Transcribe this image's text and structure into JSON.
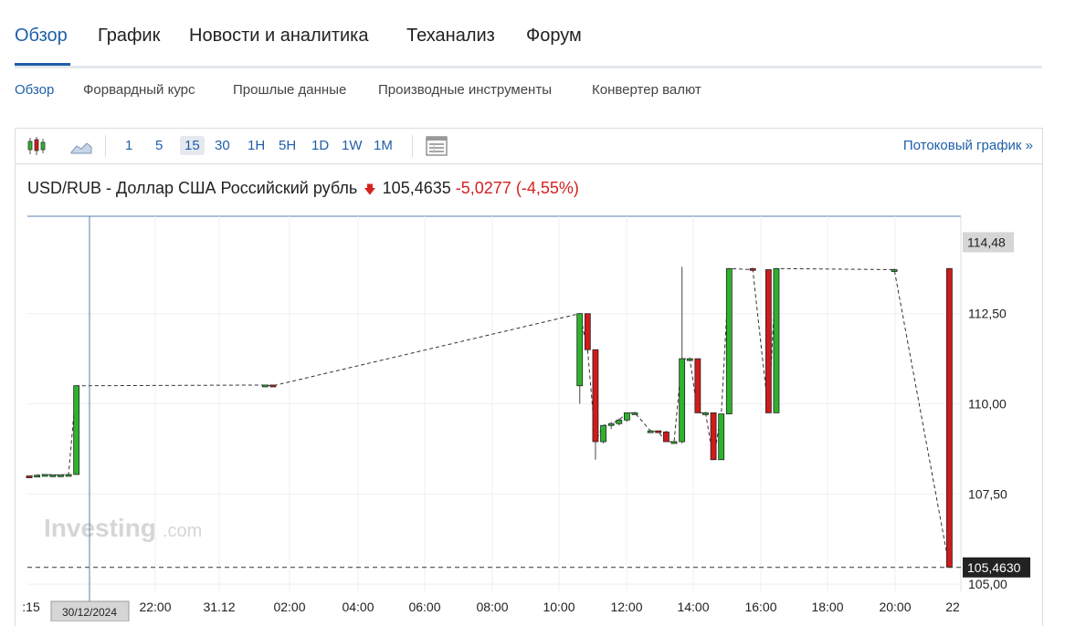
{
  "tabs": [
    {
      "label": "Обзор",
      "active": true
    },
    {
      "label": "График",
      "active": false
    },
    {
      "label": "Новости и аналитика",
      "active": false
    },
    {
      "label": "Теханализ",
      "active": false
    },
    {
      "label": "Форум",
      "active": false
    }
  ],
  "subtabs": [
    {
      "label": "Обзор",
      "active": true
    },
    {
      "label": "Форвардный курс",
      "active": false
    },
    {
      "label": "Прошлые данные",
      "active": false
    },
    {
      "label": "Производные инструменты",
      "active": false
    },
    {
      "label": "Конвертер валют",
      "active": false
    }
  ],
  "toolbar": {
    "icons": [
      "candlestick-chart-icon",
      "area-chart-icon",
      "data-table-icon"
    ],
    "intervals": [
      "1",
      "5",
      "15",
      "30",
      "1H",
      "5H",
      "1D",
      "1W",
      "1M"
    ],
    "active_interval": "15",
    "stream_label": "Потоковый график »"
  },
  "quote": {
    "name": "USD/RUB - Доллар США Российский рубль",
    "price": "105,4635",
    "change": "-5,0277",
    "change_pct": "(-4,55%)",
    "direction_color": "#d42121"
  },
  "colors": {
    "up": "#2db32d",
    "down": "#d11a1a",
    "accent": "#1f5fa8"
  },
  "chart_data": {
    "type": "candlestick",
    "y_ticks": [
      "112,50",
      "110,00",
      "107,50",
      "105,00"
    ],
    "y_tick_values": [
      112.5,
      110.0,
      107.5,
      105.0
    ],
    "ylim": [
      104.8,
      115.2
    ],
    "x_ticks": [
      ":15",
      "22:00",
      "31.12",
      "02:00",
      "04:00",
      "06:00",
      "08:00",
      "10:00",
      "12:00",
      "14:00",
      "16:00",
      "18:00",
      "20:00",
      "22"
    ],
    "high_label": "114,48",
    "last_label": "105,4630",
    "last_value": 105.463,
    "high_value": 114.48,
    "crosshair_date": "30/12/2024",
    "watermark": "Investing.com",
    "candles": [
      {
        "t": 0,
        "o": 108.0,
        "h": 108.0,
        "l": 107.96,
        "c": 107.98
      },
      {
        "t": 1,
        "o": 107.98,
        "h": 108.02,
        "l": 107.98,
        "c": 108.02
      },
      {
        "t": 2,
        "o": 108.02,
        "h": 108.04,
        "l": 108.0,
        "c": 108.04
      },
      {
        "t": 3,
        "o": 108.03,
        "h": 108.04,
        "l": 108.02,
        "c": 108.03
      },
      {
        "t": 4,
        "o": 108.0,
        "h": 108.04,
        "l": 108.0,
        "c": 108.03
      },
      {
        "t": 5,
        "o": 108.03,
        "h": 108.05,
        "l": 108.01,
        "c": 108.04
      },
      {
        "t": 6,
        "o": 108.04,
        "h": 110.5,
        "l": 108.03,
        "c": 110.5
      },
      {
        "t": 30,
        "o": 110.5,
        "h": 110.52,
        "l": 110.48,
        "c": 110.52
      },
      {
        "t": 31,
        "o": 110.52,
        "h": 110.53,
        "l": 110.5,
        "c": 110.5
      },
      {
        "t": 70,
        "o": 110.5,
        "h": 112.5,
        "l": 110.0,
        "c": 112.5
      },
      {
        "t": 71,
        "o": 112.5,
        "h": 112.5,
        "l": 111.5,
        "c": 111.5
      },
      {
        "t": 72,
        "o": 111.5,
        "h": 111.5,
        "l": 108.45,
        "c": 108.95
      },
      {
        "t": 73,
        "o": 108.95,
        "h": 109.4,
        "l": 108.9,
        "c": 109.4
      },
      {
        "t": 74,
        "o": 109.4,
        "h": 109.5,
        "l": 109.3,
        "c": 109.45
      },
      {
        "t": 75,
        "o": 109.45,
        "h": 109.6,
        "l": 109.4,
        "c": 109.55
      },
      {
        "t": 76,
        "o": 109.55,
        "h": 109.75,
        "l": 109.5,
        "c": 109.75
      },
      {
        "t": 77,
        "o": 109.75,
        "h": 109.78,
        "l": 109.7,
        "c": 109.75
      },
      {
        "t": 79,
        "o": 109.25,
        "h": 109.27,
        "l": 109.22,
        "c": 109.25
      },
      {
        "t": 80,
        "o": 109.25,
        "h": 109.25,
        "l": 109.22,
        "c": 109.22
      },
      {
        "t": 81,
        "o": 109.22,
        "h": 109.25,
        "l": 108.95,
        "c": 108.95
      },
      {
        "t": 82,
        "o": 108.95,
        "h": 108.97,
        "l": 108.9,
        "c": 108.95
      },
      {
        "t": 83,
        "o": 108.95,
        "h": 113.8,
        "l": 108.9,
        "c": 111.25
      },
      {
        "t": 84,
        "o": 111.25,
        "h": 111.28,
        "l": 111.2,
        "c": 111.25
      },
      {
        "t": 85,
        "o": 111.25,
        "h": 111.25,
        "l": 109.75,
        "c": 109.75
      },
      {
        "t": 86,
        "o": 109.75,
        "h": 109.78,
        "l": 109.7,
        "c": 109.75
      },
      {
        "t": 87,
        "o": 109.75,
        "h": 109.75,
        "l": 108.45,
        "c": 108.45
      },
      {
        "t": 88,
        "o": 108.45,
        "h": 109.72,
        "l": 108.45,
        "c": 109.72
      },
      {
        "t": 89,
        "o": 109.72,
        "h": 113.75,
        "l": 109.72,
        "c": 113.75
      },
      {
        "t": 92,
        "o": 113.75,
        "h": 113.77,
        "l": 113.7,
        "c": 113.72
      },
      {
        "t": 94,
        "o": 113.72,
        "h": 113.72,
        "l": 109.75,
        "c": 109.75
      },
      {
        "t": 95,
        "o": 109.75,
        "h": 113.75,
        "l": 109.75,
        "c": 113.75
      },
      {
        "t": 110,
        "o": 113.72,
        "h": 113.75,
        "l": 113.7,
        "c": 113.72
      },
      {
        "t": 117,
        "o": 113.75,
        "h": 113.77,
        "l": 105.47,
        "c": 105.47
      }
    ]
  }
}
